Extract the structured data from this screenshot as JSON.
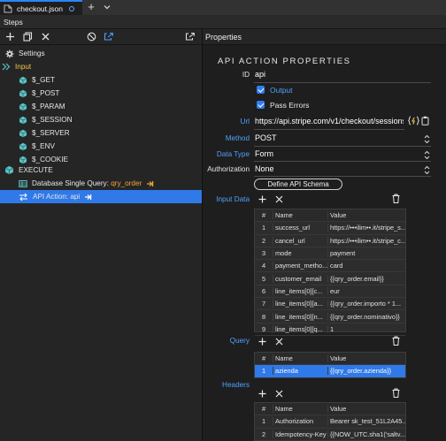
{
  "tab": {
    "filename": "checkout.json"
  },
  "steps": {
    "title": "Steps"
  },
  "properties": {
    "title": "Properties"
  },
  "tree": [
    {
      "label": "Settings",
      "accent": ""
    },
    {
      "label": "Input",
      "accent": ""
    },
    {
      "label": "$_GET",
      "accent": ""
    },
    {
      "label": "$_POST",
      "accent": ""
    },
    {
      "label": "$_PARAM",
      "accent": ""
    },
    {
      "label": "$_SESSION",
      "accent": ""
    },
    {
      "label": "$_SERVER",
      "accent": ""
    },
    {
      "label": "$_ENV",
      "accent": ""
    },
    {
      "label": "$_COOKIE",
      "accent": ""
    },
    {
      "label": "EXECUTE",
      "accent": ""
    },
    {
      "label": "Database Single Query: ",
      "accent": "qry_order"
    },
    {
      "label": "API Action: api",
      "accent": ""
    }
  ],
  "form": {
    "section_title": "API ACTION PROPERTIES",
    "id_label": "ID",
    "id_value": "api",
    "output_label": "Output",
    "pass_errors_label": "Pass Errors",
    "url_label": "Url",
    "url_value": "https://api.stripe.com/v1/checkout/sessions",
    "method_label": "Method",
    "method_value": "POST",
    "data_type_label": "Data Type",
    "data_type_value": "Form",
    "authorization_label": "Authorization",
    "authorization_value": "None",
    "define_schema_button": "Define API Schema",
    "input_data_label": "Input Data",
    "query_label": "Query",
    "headers_label": "Headers"
  },
  "grid_headers": {
    "idx": "#",
    "name": "Name",
    "value": "Value"
  },
  "input_data_rows": [
    {
      "idx": "1",
      "name": "success_url",
      "value": "https://•••ilim••.it/stripe_s..."
    },
    {
      "idx": "2",
      "name": "cancel_url",
      "value": "https://•••ilim••.it/stripe_c..."
    },
    {
      "idx": "3",
      "name": "mode",
      "value": "payment"
    },
    {
      "idx": "4",
      "name": "payment_metho...",
      "value": "card"
    },
    {
      "idx": "5",
      "name": "customer_email",
      "value": "{{qry_order.email}}"
    },
    {
      "idx": "6",
      "name": "line_items[0][c...",
      "value": "eur"
    },
    {
      "idx": "7",
      "name": "line_items[0][a...",
      "value": "{{qry_order.importo * 1..."
    },
    {
      "idx": "8",
      "name": "line_items[0][n...",
      "value": "{{qry_order.nominativo}}"
    },
    {
      "idx": "9",
      "name": "line_items[0][q...",
      "value": "1"
    }
  ],
  "query_rows": [
    {
      "idx": "1",
      "name": "azienda",
      "value": "{{qry_order.azienda}}"
    }
  ],
  "header_rows": [
    {
      "idx": "1",
      "name": "Authorization",
      "value": "Bearer sk_test_51L2A45..."
    },
    {
      "idx": "2",
      "name": "Idempotency-Key",
      "value": "{{NOW_UTC.sha1('saltv..."
    }
  ],
  "colors": {
    "accent_blue": "#2f79e8",
    "label_blue": "#4ea1ff",
    "step_accent": "#f0a73a",
    "icon_teal": "#5cc4c4"
  }
}
